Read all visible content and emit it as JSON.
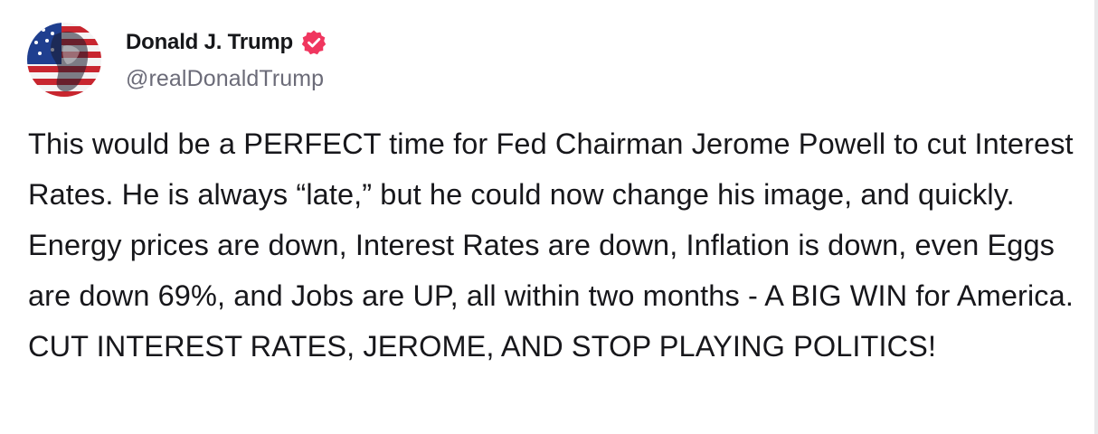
{
  "author": {
    "display_name": "Donald J. Trump",
    "handle": "@realDonaldTrump",
    "avatar_icon": "avatar-flag-portrait",
    "verified_icon": "verified-badge-icon"
  },
  "post": {
    "text": "This would be a PERFECT time for Fed Chairman Jerome Powell to cut Interest Rates. He is always “late,” but he could now change his image, and quickly. Energy prices are down, Interest Rates are down, Inflation is down, even Eggs are down 69%, and Jobs are UP, all within two months - A BIG WIN for America. CUT INTEREST RATES, JEROME, AND STOP PLAYING POLITICS!"
  },
  "colors": {
    "verified_badge": "#f0365f",
    "text_primary": "#17171b",
    "text_secondary": "#6b6b78"
  }
}
